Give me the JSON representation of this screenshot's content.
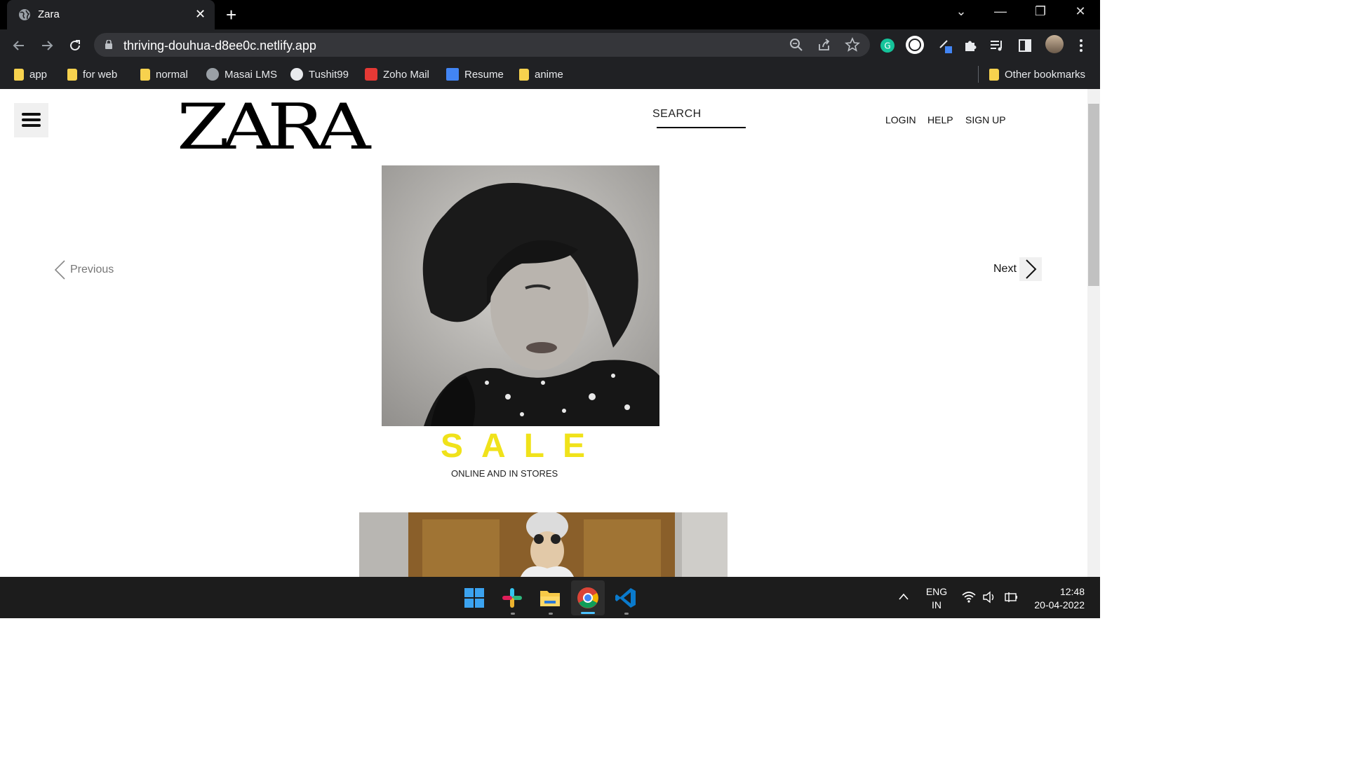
{
  "browser": {
    "tab_title": "Zara",
    "url": "thriving-douhua-d8ee0c.netlify.app",
    "bookmarks": [
      {
        "label": "app",
        "icon": "folder-icon"
      },
      {
        "label": "for web",
        "icon": "folder-icon"
      },
      {
        "label": "normal",
        "icon": "folder-icon"
      },
      {
        "label": "Masai LMS",
        "icon": "globe-icon"
      },
      {
        "label": "Tushit99",
        "icon": "github-icon"
      },
      {
        "label": "Zoho Mail",
        "icon": "zoho-icon"
      },
      {
        "label": "Resume",
        "icon": "docs-icon"
      },
      {
        "label": "anime",
        "icon": "folder-icon"
      }
    ],
    "other_bookmarks": "Other bookmarks"
  },
  "header": {
    "logo": "ZARA",
    "search_label": "SEARCH",
    "nav": {
      "login": "LOGIN",
      "help": "HELP",
      "signup": "SIGN UP"
    }
  },
  "carousel": {
    "prev_label": "Previous",
    "next_label": "Next"
  },
  "promo": {
    "title": "SALE",
    "subtitle": "ONLINE AND IN STORES",
    "title_color": "#f0e21a"
  },
  "taskbar": {
    "lang_line1": "ENG",
    "lang_line2": "IN",
    "time": "12:48",
    "date": "20-04-2022"
  }
}
